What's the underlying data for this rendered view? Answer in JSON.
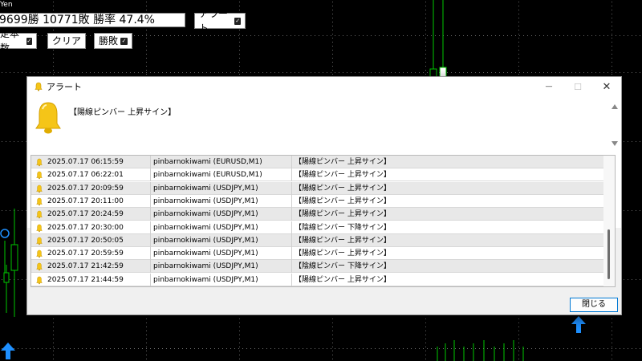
{
  "window_label": "Yen",
  "stats": {
    "text": "9699勝 10771敗  勝率 47.4%"
  },
  "buttons": {
    "alert_label": "アラート",
    "fixed_count_label": "定本数",
    "clear_label": "クリア",
    "win_loss_label": "勝敗",
    "check_mark": "✓"
  },
  "dialog": {
    "title": "アラート",
    "minimize": "—",
    "maximize": "☐",
    "close": "✕",
    "message": "【陽線ピンバー 上昇サイン】",
    "close_button_label": "閉じる"
  },
  "alerts": [
    {
      "time": "2025.07.17 06:15:59",
      "ea": "pinbarnokiwami (EURUSD,M1)",
      "message": "【陽線ピンバー 上昇サイン】"
    },
    {
      "time": "2025.07.17 06:22:01",
      "ea": "pinbarnokiwami (EURUSD,M1)",
      "message": "【陽線ピンバー 上昇サイン】"
    },
    {
      "time": "2025.07.17 20:09:59",
      "ea": "pinbarnokiwami (USDJPY,M1)",
      "message": "【陽線ピンバー 上昇サイン】"
    },
    {
      "time": "2025.07.17 20:11:00",
      "ea": "pinbarnokiwami (USDJPY,M1)",
      "message": "【陽線ピンバー 上昇サイン】"
    },
    {
      "time": "2025.07.17 20:24:59",
      "ea": "pinbarnokiwami (USDJPY,M1)",
      "message": "【陽線ピンバー 上昇サイン】"
    },
    {
      "time": "2025.07.17 20:30:00",
      "ea": "pinbarnokiwami (USDJPY,M1)",
      "message": "【陰線ピンバー 下降サイン】"
    },
    {
      "time": "2025.07.17 20:50:05",
      "ea": "pinbarnokiwami (USDJPY,M1)",
      "message": "【陽線ピンバー 上昇サイン】"
    },
    {
      "time": "2025.07.17 20:59:59",
      "ea": "pinbarnokiwami (USDJPY,M1)",
      "message": "【陽線ピンバー 上昇サイン】"
    },
    {
      "time": "2025.07.17 21:42:59",
      "ea": "pinbarnokiwami (USDJPY,M1)",
      "message": "【陰線ピンバー 下降サイン】"
    },
    {
      "time": "2025.07.17 21:44:59",
      "ea": "pinbarnokiwami (USDJPY,M1)",
      "message": "【陽線ピンバー 上昇サイン】"
    }
  ],
  "icons": {
    "bell": "bell-icon",
    "arrow": "up-arrow-icon"
  },
  "colors": {
    "chart_bg": "#000000",
    "candle_green": "#00c800",
    "arrow_blue": "#1e90ff",
    "bell_gold": "#f5c518",
    "accent_blue": "#0078d4"
  }
}
